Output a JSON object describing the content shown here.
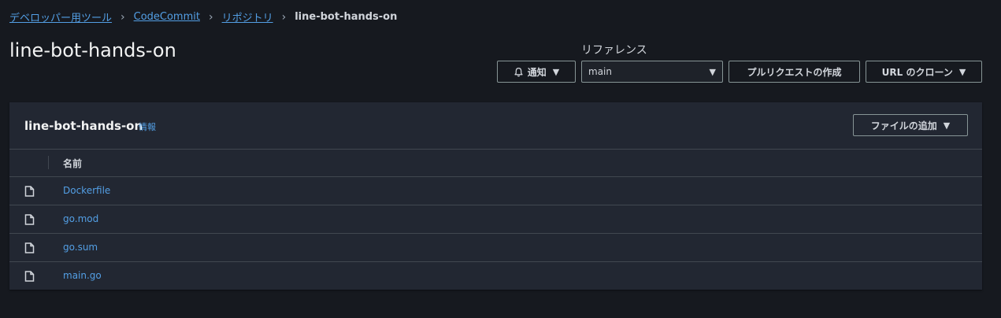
{
  "breadcrumb": {
    "items": [
      "デベロッパー用ツール",
      "CodeCommit",
      "リポジトリ"
    ],
    "current": "line-bot-hands-on"
  },
  "header": {
    "title": "line-bot-hands-on",
    "reference_label": "リファレンス",
    "notify_label": "通知",
    "branch_value": "main",
    "pull_request_label": "プルリクエストの作成",
    "clone_label": "URL のクローン"
  },
  "panel": {
    "title": "line-bot-hands-on",
    "info_label": "情報",
    "add_file_label": "ファイルの追加",
    "column_name": "名前",
    "files": [
      "Dockerfile",
      "go.mod",
      "go.sum",
      "main.go"
    ]
  },
  "colors": {
    "background": "#16191f",
    "panel": "#222732",
    "link": "#539fe5",
    "border": "#879596"
  },
  "icons": [
    "chevron-right-icon",
    "bell-icon",
    "caret-down-icon",
    "file-icon"
  ]
}
